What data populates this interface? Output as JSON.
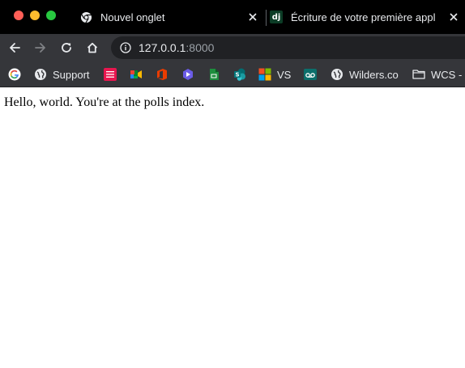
{
  "window": {
    "traffic_lights": [
      "close",
      "minimize",
      "zoom"
    ],
    "colors": {
      "close": "#ff5f57",
      "minimize": "#febc2e",
      "zoom": "#28c840"
    }
  },
  "tabs": [
    {
      "title": "Nouvel onglet",
      "icon": "chrome-icon",
      "close_label": "×"
    },
    {
      "title": "Écriture de votre première appl",
      "icon": "django-icon",
      "icon_text": "dj",
      "close_label": "×"
    }
  ],
  "toolbar": {
    "url_host": "127.0.0.1",
    "url_port": ":8000"
  },
  "bookmarks": [
    {
      "label": "",
      "icon": "google-icon"
    },
    {
      "label": "Support",
      "icon": "globe-icon"
    },
    {
      "label": "",
      "icon": "app-icon-pink"
    },
    {
      "label": "",
      "icon": "meet-icon"
    },
    {
      "label": "",
      "icon": "office-icon"
    },
    {
      "label": "",
      "icon": "azure-devops-icon"
    },
    {
      "label": "",
      "icon": "sheets-icon"
    },
    {
      "label": "",
      "icon": "sharepoint-icon"
    },
    {
      "label": "VS",
      "icon": "microsoft-icon"
    },
    {
      "label": "",
      "icon": "voicemail-icon"
    },
    {
      "label": "Wilders.co",
      "icon": "globe-icon"
    },
    {
      "label": "WCS -",
      "icon": "folder-icon"
    }
  ],
  "page": {
    "text": "Hello, world. You're at the polls index."
  }
}
